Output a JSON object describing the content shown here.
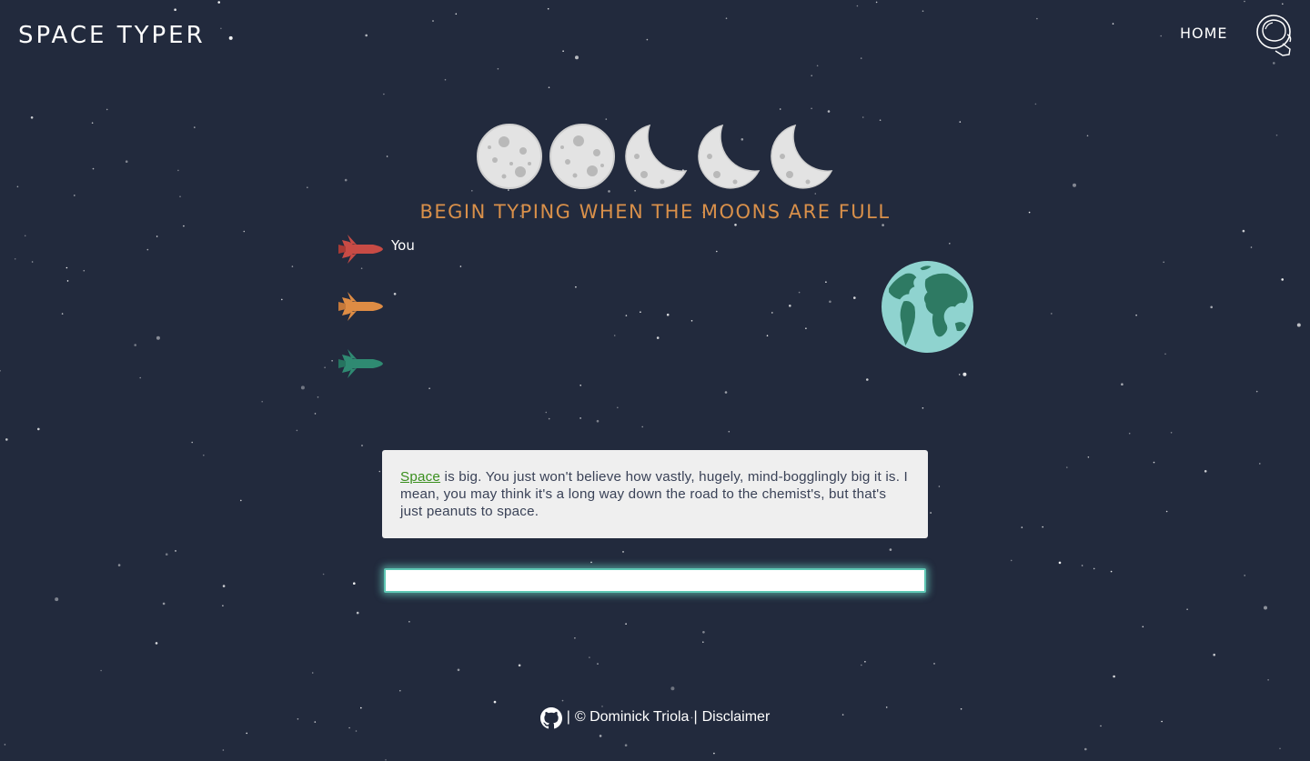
{
  "header": {
    "logo": "SPACE TYPER",
    "nav_home": "HOME",
    "helmet_icon": "astronaut-helmet-icon"
  },
  "countdown": {
    "headline": "BEGIN TYPING WHEN THE MOONS ARE FULL",
    "moons": [
      "full",
      "full",
      "crescent",
      "crescent",
      "crescent"
    ]
  },
  "race": {
    "racers": [
      {
        "label": "You",
        "color": "#c84b45"
      },
      {
        "label": "",
        "color": "#de8c44"
      },
      {
        "label": "",
        "color": "#2f8a72"
      }
    ],
    "progress": [
      0,
      0,
      0
    ],
    "goal_icon": "earth-icon"
  },
  "quote": {
    "current_word": "Space",
    "rest": " is big. You just won't believe how vastly, hugely, mind-bogglingly big it is. I mean, you may think it's a long way down the road to the chemist's, but that's just peanuts to space."
  },
  "input": {
    "value": "",
    "placeholder": ""
  },
  "footer": {
    "separator1": "|",
    "copyright": "© Dominick Triola",
    "separator2": "|",
    "disclaimer": "Disclaimer",
    "github_icon": "github-icon"
  },
  "colors": {
    "background": "#222a3d",
    "headline": "#d9904a",
    "earth_ocean": "#8fd3cf",
    "earth_land": "#2e7a63",
    "input_glow": "#5ec7b4",
    "word_highlight": "#3a8f1e"
  }
}
